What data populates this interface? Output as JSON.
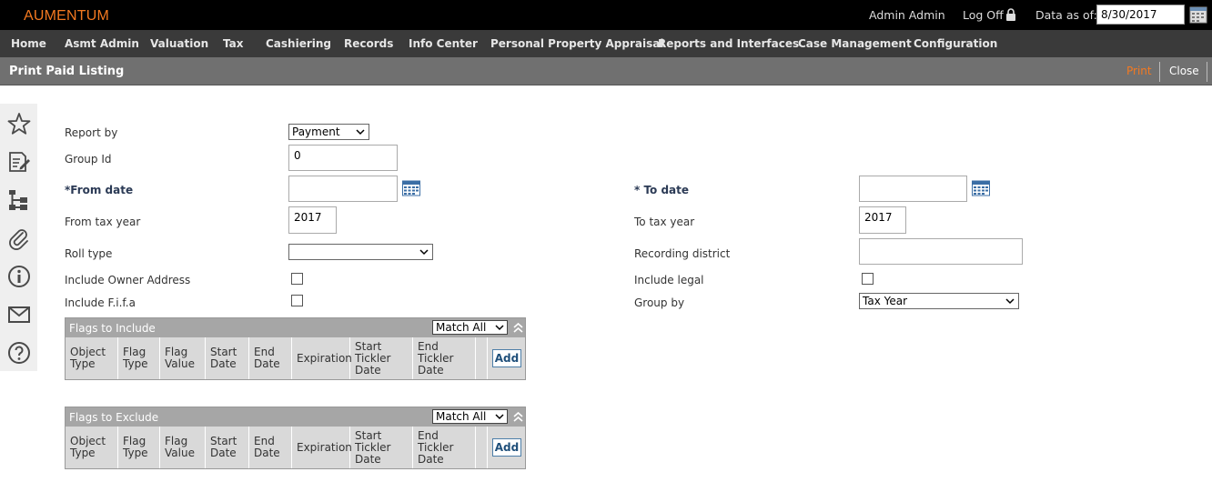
{
  "app": {
    "logo": "AUMENTUM",
    "user": "Admin Admin",
    "logoff": "Log Off",
    "data_as_of_label": "Data as of:",
    "data_as_of_value": "8/30/2017"
  },
  "nav": [
    "Home",
    "Asmt Admin",
    "Valuation",
    "Tax",
    "Cashiering",
    "Records",
    "Info Center",
    "Personal Property Appraisal",
    "Reports and Interfaces",
    "Case Management",
    "Configuration"
  ],
  "title": {
    "text": "Print Paid Listing",
    "print": "Print",
    "close": "Close"
  },
  "sidebar_icons": [
    "star-icon",
    "edit-note-icon",
    "hierarchy-icon",
    "paperclip-icon",
    "info-icon",
    "mail-icon",
    "help-icon"
  ],
  "form": {
    "report_by": {
      "label": "Report by",
      "value": "Payment"
    },
    "group_id": {
      "label": "Group Id",
      "value": "0"
    },
    "from_date": {
      "label": "*From date",
      "value": ""
    },
    "to_date": {
      "label": "* To date",
      "value": ""
    },
    "from_tax_year": {
      "label": "From tax year",
      "value": "2017"
    },
    "to_tax_year": {
      "label": "To tax year",
      "value": "2017"
    },
    "roll_type": {
      "label": "Roll type",
      "value": ""
    },
    "recording_district": {
      "label": "Recording district",
      "value": ""
    },
    "include_owner_address": {
      "label": "Include Owner Address",
      "checked": false
    },
    "include_legal": {
      "label": "Include legal",
      "checked": false
    },
    "include_fifa": {
      "label": "Include F.i.f.a",
      "checked": false
    },
    "group_by": {
      "label": "Group by",
      "value": "Tax Year"
    }
  },
  "flags_include": {
    "title": "Flags to Include",
    "match": "Match All"
  },
  "flags_exclude": {
    "title": "Flags to Exclude",
    "match": "Match All"
  },
  "flag_columns": [
    "Object Type",
    "Flag Type",
    "Flag Value",
    "Start Date",
    "End Date",
    "Expiration",
    "Start Tickler Date",
    "End Tickler Date"
  ],
  "add_label": "Add"
}
